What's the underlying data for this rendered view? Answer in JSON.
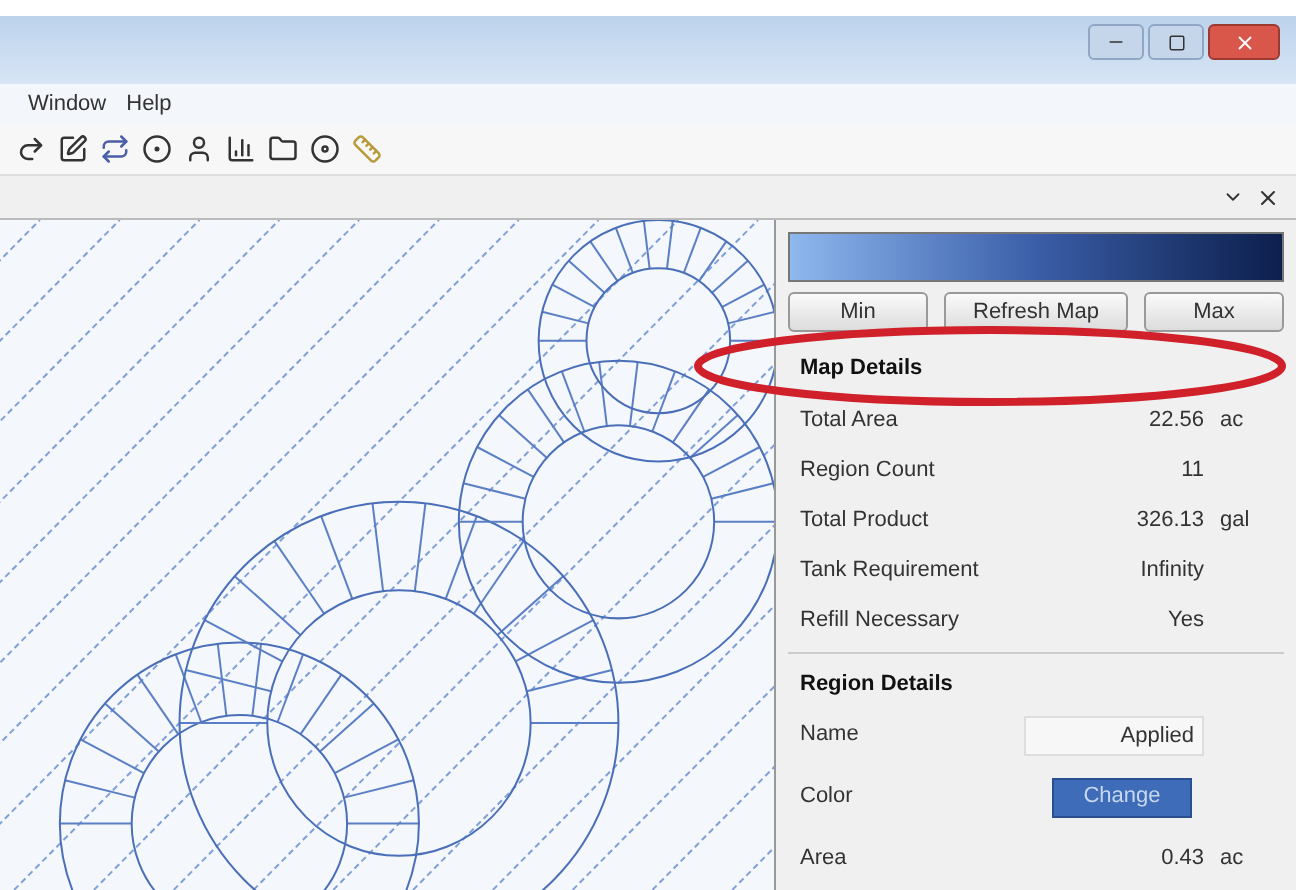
{
  "menu": [
    "Window",
    "Help"
  ],
  "map_buttons": [
    "Min",
    "Refresh Map",
    "Max"
  ],
  "map_details": {
    "title": "Map Details",
    "rows": [
      {
        "label": "Total Area",
        "value": "22.56",
        "unit": "ac"
      },
      {
        "label": "Region Count",
        "value": "11"
      },
      {
        "label": "Total Product",
        "value": "326.13",
        "unit": "gal"
      },
      {
        "label": "Tank Requirement",
        "value": "Infinity"
      },
      {
        "label": "Refill Necessary",
        "value": "Yes"
      }
    ]
  },
  "region_details": {
    "title": "Region Details",
    "rows": [
      {
        "kind": "field",
        "label": "Name",
        "value": "Applied"
      },
      {
        "kind": "button",
        "label": "Color",
        "value": "Change"
      },
      {
        "kind": "text",
        "label": "Area",
        "value": "0.43",
        "unit": "ac"
      }
    ]
  }
}
